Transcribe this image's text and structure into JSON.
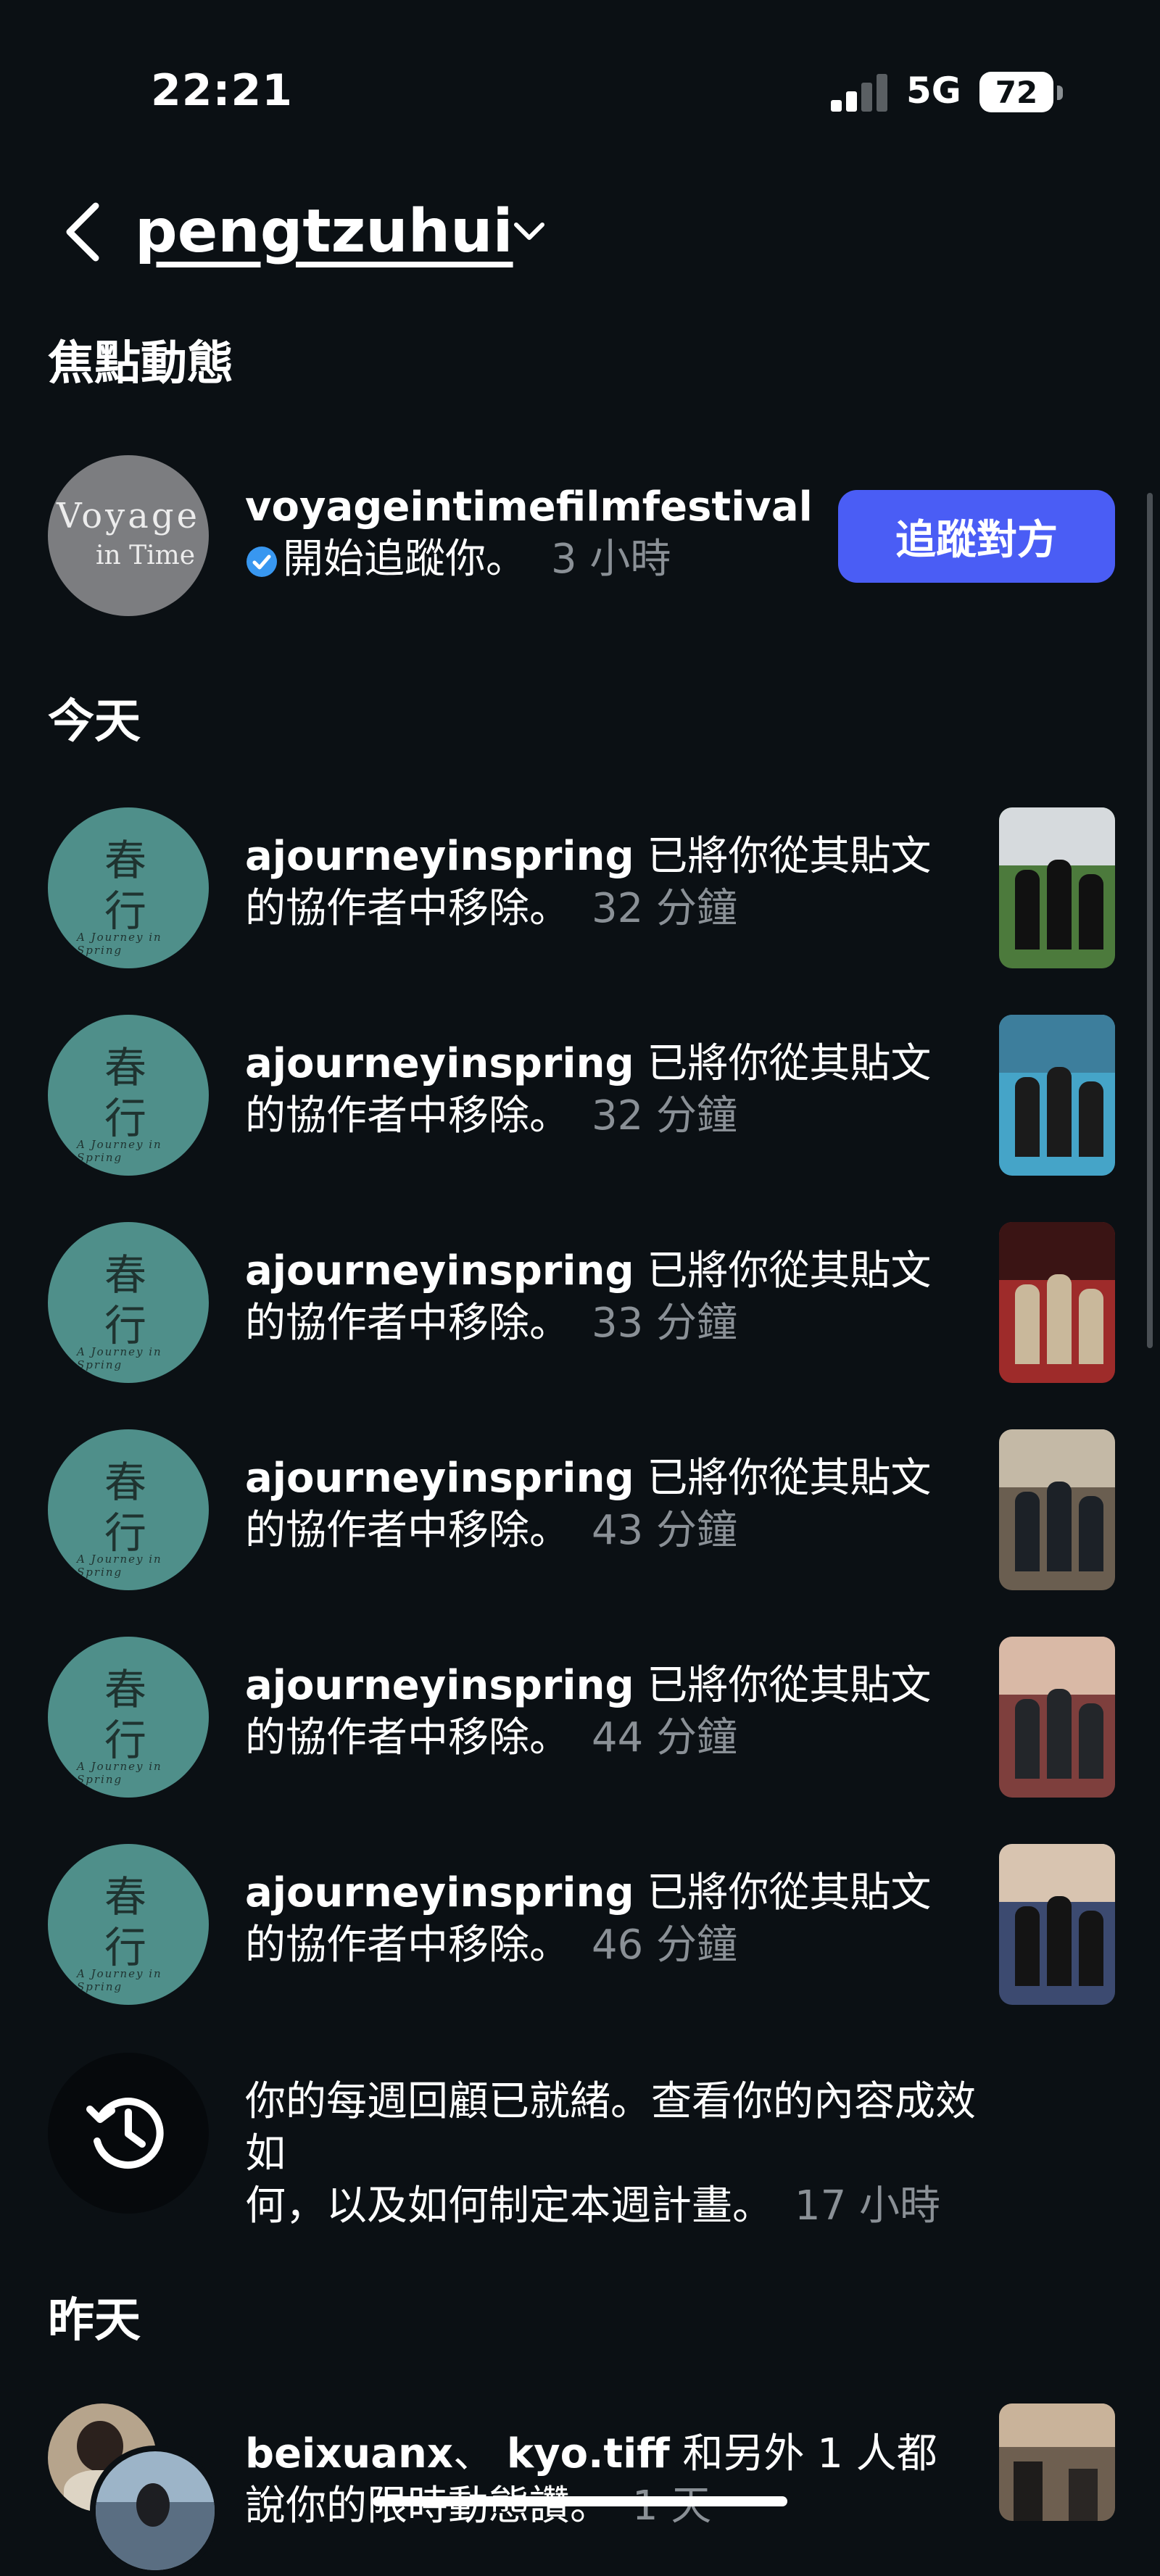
{
  "status_bar": {
    "time": "22:21",
    "network": "5G",
    "battery": "72"
  },
  "header": {
    "username": "pengtzuhui"
  },
  "sections": {
    "featured": "焦點動態",
    "today": "今天",
    "yesterday": "昨天"
  },
  "featured": {
    "avatar_line1": "Voyage",
    "avatar_line2": "in Time",
    "account": "voyageintimefilmfestival",
    "text": "開始追蹤你。",
    "time": "3 小時",
    "button": "追蹤對方"
  },
  "spring_avatar": {
    "char1": "春",
    "char2": "行",
    "sub": "A Journey in Spring"
  },
  "today_items": [
    {
      "account": "ajourneyinspring",
      "text_a": " 已將你從其貼文",
      "text_b": "的協作者中移除。",
      "time": "32 分鐘"
    },
    {
      "account": "ajourneyinspring",
      "text_a": " 已將你從其貼文",
      "text_b": "的協作者中移除。",
      "time": "32 分鐘"
    },
    {
      "account": "ajourneyinspring",
      "text_a": " 已將你從其貼文",
      "text_b": "的協作者中移除。",
      "time": "33 分鐘"
    },
    {
      "account": "ajourneyinspring",
      "text_a": " 已將你從其貼文",
      "text_b": "的協作者中移除。",
      "time": "43 分鐘"
    },
    {
      "account": "ajourneyinspring",
      "text_a": " 已將你從其貼文",
      "text_b": "的協作者中移除。",
      "time": "44 分鐘"
    },
    {
      "account": "ajourneyinspring",
      "text_a": " 已將你從其貼文",
      "text_b": "的協作者中移除。",
      "time": "46 分鐘"
    }
  ],
  "recap": {
    "line1": "你的每週回顧已就緒。查看你的內容成效如",
    "line2": "何，以及如何制定本週計畫。",
    "time": "17 小時"
  },
  "yesterday_item": {
    "account1": "beixuanx",
    "sep": "、 ",
    "account2": "kyo.tiff",
    "text": " 和另外 1 人都",
    "line2": "說你的限時動態讚。",
    "time": "1 天"
  },
  "colors": {
    "background": "#0b1014",
    "button": "#4a5df5",
    "muted": "#8a9096",
    "verified": "#3897f0"
  }
}
